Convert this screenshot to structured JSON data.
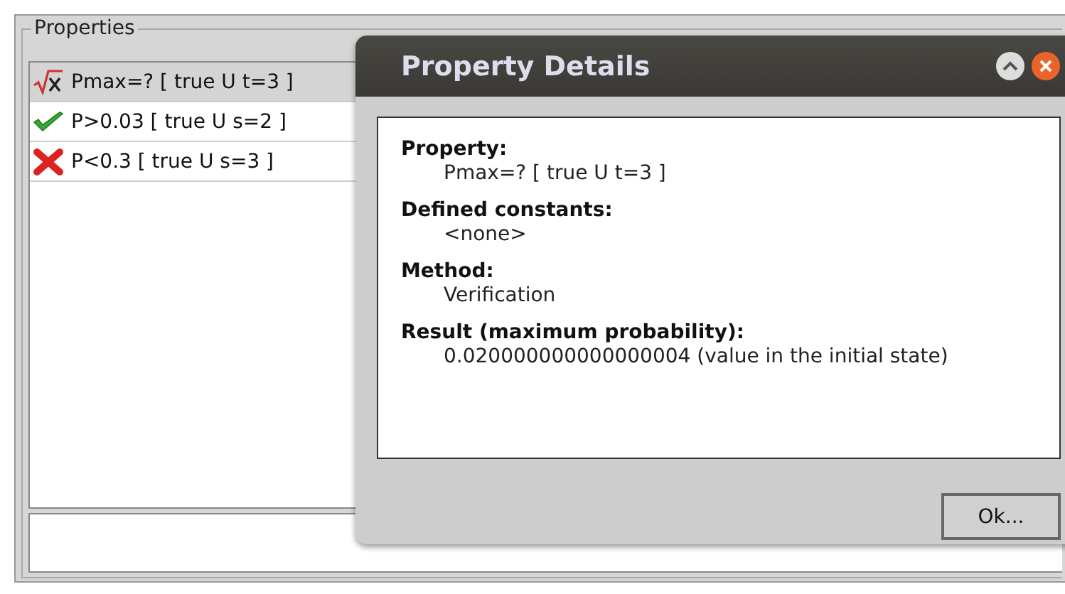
{
  "panel": {
    "title": "Properties",
    "properties": [
      {
        "label": "Pmax=? [ true U t=3 ]",
        "kind": "unknown",
        "selected": true
      },
      {
        "label": "P>0.03 [ true U s=2 ]",
        "kind": "satisfied",
        "selected": false
      },
      {
        "label": "P<0.3 [ true U s=3 ]",
        "kind": "failed",
        "selected": false
      }
    ]
  },
  "dialog": {
    "title": "Property Details",
    "sections": [
      {
        "heading": "Property:",
        "value": "Pmax=? [ true U t=3 ]"
      },
      {
        "heading": "Defined constants:",
        "value": "<none>"
      },
      {
        "heading": "Method:",
        "value": "Verification"
      },
      {
        "heading": "Result (maximum probability):",
        "value": "0.020000000000000004 (value in the initial state)"
      }
    ],
    "ok_button": "Ok..."
  }
}
